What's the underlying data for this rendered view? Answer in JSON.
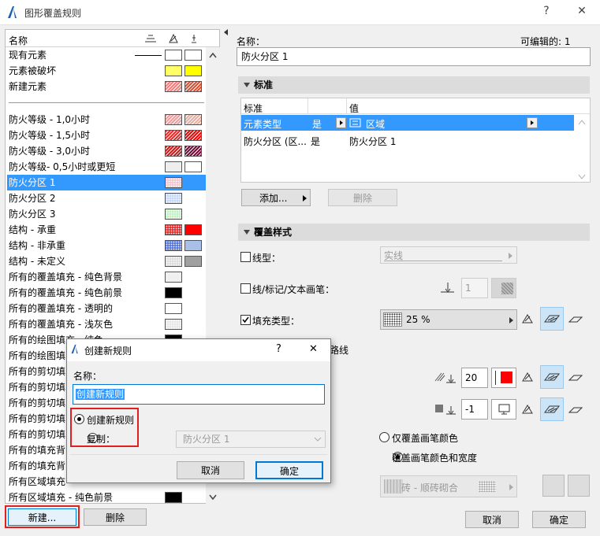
{
  "window": {
    "title": "图形覆盖规则",
    "help": "?",
    "close": "✕"
  },
  "list": {
    "header": "名称",
    "rules": [
      {
        "label": "现有元素",
        "line": true,
        "c1": "#ffffff",
        "c2": "#ffffff"
      },
      {
        "label": "元素被破坏",
        "c1": "#ffff66",
        "c2": "#ffff00"
      },
      {
        "label": "新建元素",
        "c1": "#f08080",
        "c2": "#e05030",
        "h1": true
      }
    ],
    "items": [
      {
        "label": "防火等级 - 1,0小时",
        "c1": "#e8a0a0",
        "c2": "#e8b0a0",
        "h1": true
      },
      {
        "label": "防火等级 - 1,5小时",
        "c1": "#e03030",
        "c2": "#ff0000",
        "h1": true
      },
      {
        "label": "防火等级 - 3,0小时",
        "c1": "#c02020",
        "c2": "#7a0a3a",
        "h1": true
      },
      {
        "label": "防火等级- 0,5小时或更短",
        "c1": "#eeeeee",
        "c2": "#ffffff"
      },
      {
        "label": "防火分区 1",
        "c1": "#f4c8d0",
        "c2": null,
        "sel": true,
        "dots": true
      },
      {
        "label": "防火分区 2",
        "c1": "#c8d8f8",
        "c2": null,
        "dots": true
      },
      {
        "label": "防火分区 3",
        "c1": "#c8f0c8",
        "c2": null,
        "dots": true
      },
      {
        "label": "结构 - 承重",
        "c1": "#e03030",
        "c2": "#ff0000",
        "dots": true
      },
      {
        "label": "结构 - 非承重",
        "c1": "#5a78d8",
        "c2": "#a8c0e8",
        "dots": true
      },
      {
        "label": "结构 - 未定义",
        "c1": "#dddddd",
        "c2": "#a0a0a0",
        "dots": true
      },
      {
        "label": "所有的覆盖填充 - 纯色背景",
        "c1": "#f0f0f0",
        "c2": null
      },
      {
        "label": "所有的覆盖填充 - 纯色前景",
        "c1": "#000000",
        "c2": null
      },
      {
        "label": "所有的覆盖填充 - 透明的",
        "c1": "#ffffff",
        "c2": null
      },
      {
        "label": "所有的覆盖填充 - 浅灰色",
        "c1": "#e8e8e8",
        "c2": null,
        "dots": true
      },
      {
        "label": "所有的绘图填充 - 纯色",
        "c1": "#000000",
        "c2": null
      },
      {
        "label": "所有的绘图填",
        "c1": null,
        "c2": null
      },
      {
        "label": "所有的剪切填",
        "c1": null,
        "c2": null
      },
      {
        "label": "所有的剪切填",
        "c1": null,
        "c2": null
      },
      {
        "label": "所有的剪切填",
        "c1": null,
        "c2": null
      },
      {
        "label": "所有的剪切填",
        "c1": null,
        "c2": null
      },
      {
        "label": "所有的剪切填",
        "c1": null,
        "c2": null
      },
      {
        "label": "所有的填充背",
        "c1": null,
        "c2": null
      },
      {
        "label": "所有的填充背",
        "c1": null,
        "c2": null
      },
      {
        "label": "所有区域填充",
        "c1": null,
        "c2": null
      },
      {
        "label": "所有区域填充 - 纯色前景",
        "c1": "#000000",
        "c2": null
      }
    ],
    "new_button": "新建...",
    "delete_button": "删除"
  },
  "props": {
    "name_label": "名称：",
    "editable_label": "可编辑的: 1",
    "name_value": "防火分区 1",
    "criteria_title": "标准",
    "col_criteria": "标准",
    "col_value": "值",
    "row1": {
      "criteria": "元素类型",
      "op": "是",
      "value": "区域"
    },
    "row2": {
      "criteria": "防火分区 (区...",
      "op": "是",
      "value": "防火分区 1"
    },
    "add_button": "添加...",
    "remove_button": "删除",
    "style_title": "覆盖样式",
    "line_type_label": "线型：",
    "line_type_value": "实线",
    "pen_label": "线/标记/文本画笔：",
    "pen_value": "1",
    "fill_type_label": "填充类型：",
    "fill_type_value": "25 %",
    "hidden_label": "路线",
    "fg_pen_value": "20",
    "fg_pen_color": "#ff0000",
    "bg_pen_value": "-1",
    "opt1": "仅覆盖画笔颜色",
    "opt2": "覆盖画笔颜色和宽度",
    "surface_value": "砖 - 顺砖砌合",
    "cancel_button": "取消",
    "ok_button": "确定"
  },
  "dialog": {
    "title": "创建新规则",
    "help": "?",
    "close": "✕",
    "name_label": "名称：",
    "name_value": "创建新规则",
    "radio_new": "创建新规则",
    "radio_copy": "复制：",
    "copy_value": "防火分区 1",
    "cancel_button": "取消",
    "ok_button": "确定"
  }
}
